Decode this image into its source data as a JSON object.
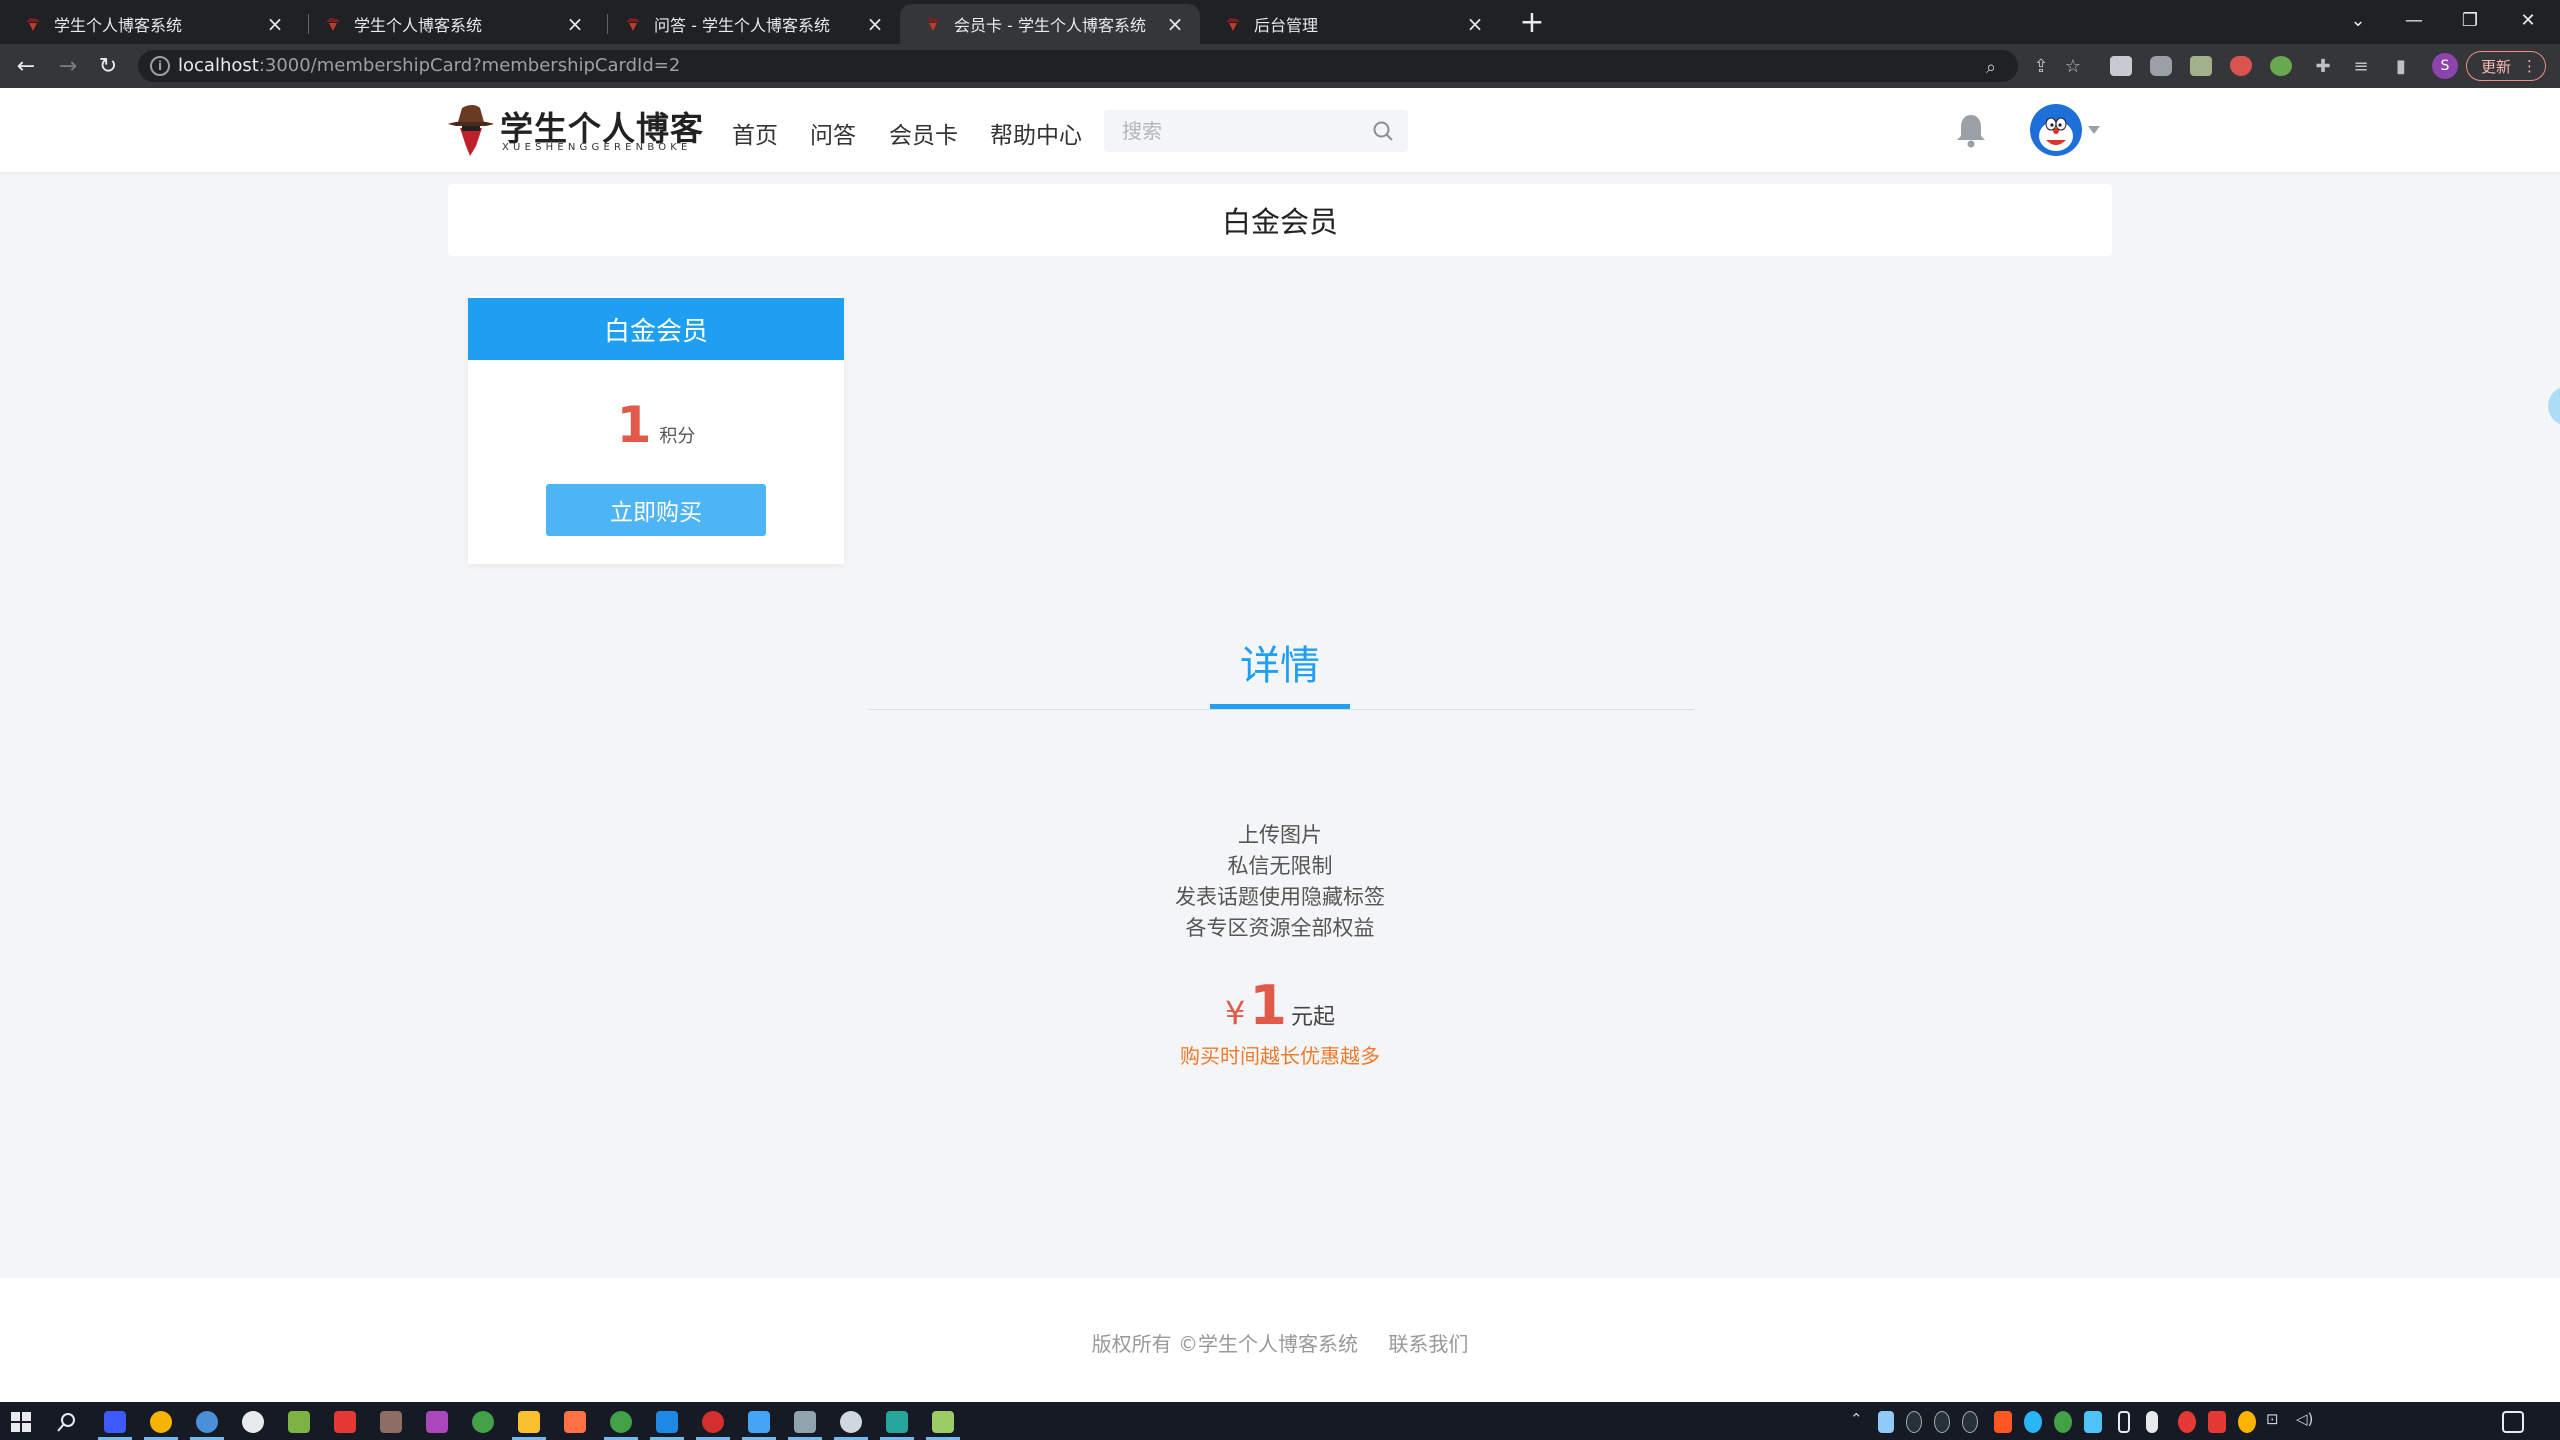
{
  "browser": {
    "tabs": [
      {
        "title": "学生个人博客系统",
        "active": false
      },
      {
        "title": "学生个人博客系统",
        "active": false
      },
      {
        "title": "问答 - 学生个人博客系统",
        "active": false
      },
      {
        "title": "会员卡 - 学生个人博客系统",
        "active": true
      },
      {
        "title": "后台管理",
        "active": false
      }
    ],
    "new_tab_label": "+",
    "url_host": "localhost",
    "url_rest": ":3000/membershipCard?membershipCardId=2",
    "profile_initial": "S",
    "update_label": "更新"
  },
  "site": {
    "logo_text": "学生个人博客",
    "logo_sub": "XUESHENGGERENBOKE",
    "nav": [
      "首页",
      "问答",
      "会员卡",
      "帮助中心"
    ],
    "search_placeholder": "搜索"
  },
  "main": {
    "page_title": "白金会员",
    "card": {
      "name": "白金会员",
      "points": "1",
      "points_unit": "积分",
      "buy_label": "立即购买"
    },
    "detail_tab": "详情",
    "features": [
      "上传图片",
      "私信无限制",
      "发表话题使用隐藏标签",
      "各专区资源全部权益"
    ],
    "price_currency": "¥",
    "price_amount": "1",
    "price_suffix": "元起",
    "promo": "购买时间越长优惠越多"
  },
  "footer": {
    "copyright": "版权所有 ©学生个人博客系统",
    "contact": "联系我们"
  },
  "colors": {
    "accent": "#1e9ff2",
    "price_red": "#e05a4a",
    "promo_orange": "#f07a2c"
  }
}
